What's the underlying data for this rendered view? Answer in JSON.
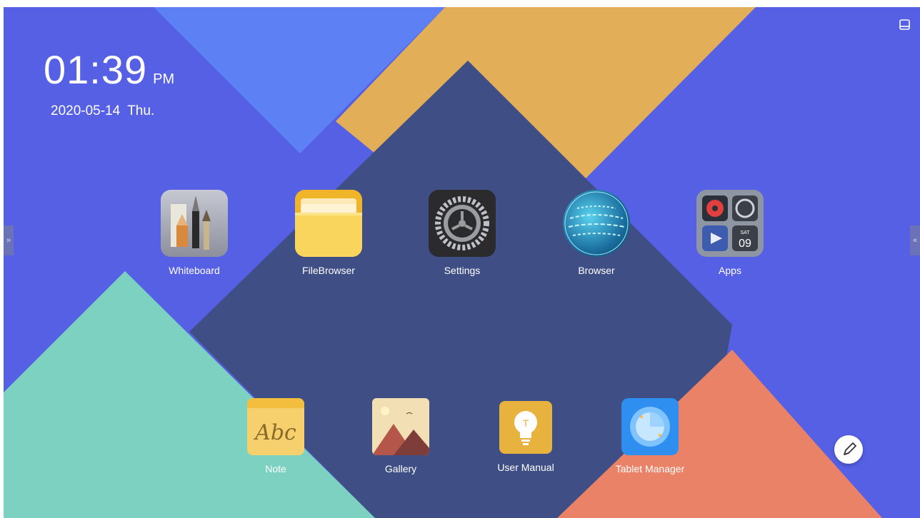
{
  "clock": {
    "time": "01:39",
    "ampm": "PM",
    "date": "2020-05-14",
    "weekday": "Thu."
  },
  "apps_row1": [
    {
      "label": "Whiteboard",
      "icon": "whiteboard-icon"
    },
    {
      "label": "FileBrowser",
      "icon": "folder-icon"
    },
    {
      "label": "Settings",
      "icon": "gear-icon"
    },
    {
      "label": "Browser",
      "icon": "globe-icon"
    },
    {
      "label": "Apps",
      "icon": "apps-folder-icon"
    }
  ],
  "apps_row2": [
    {
      "label": "Note",
      "icon": "note-icon"
    },
    {
      "label": "Gallery",
      "icon": "gallery-icon"
    },
    {
      "label": "User Manual",
      "icon": "lightbulb-icon"
    },
    {
      "label": "Tablet Manager",
      "icon": "tablet-manager-icon"
    }
  ],
  "icons": {
    "note_text": "Abc",
    "apps_calendar_day": "SAT",
    "apps_calendar_date": "09"
  },
  "edges": {
    "left": "»",
    "right": "«"
  },
  "colors": {
    "blue": "#5661e6",
    "light_blue": "#5d80f5",
    "orange": "#e2ae57",
    "navy": "#3f4f86",
    "teal": "#7dd1c1",
    "coral": "#e98266"
  }
}
